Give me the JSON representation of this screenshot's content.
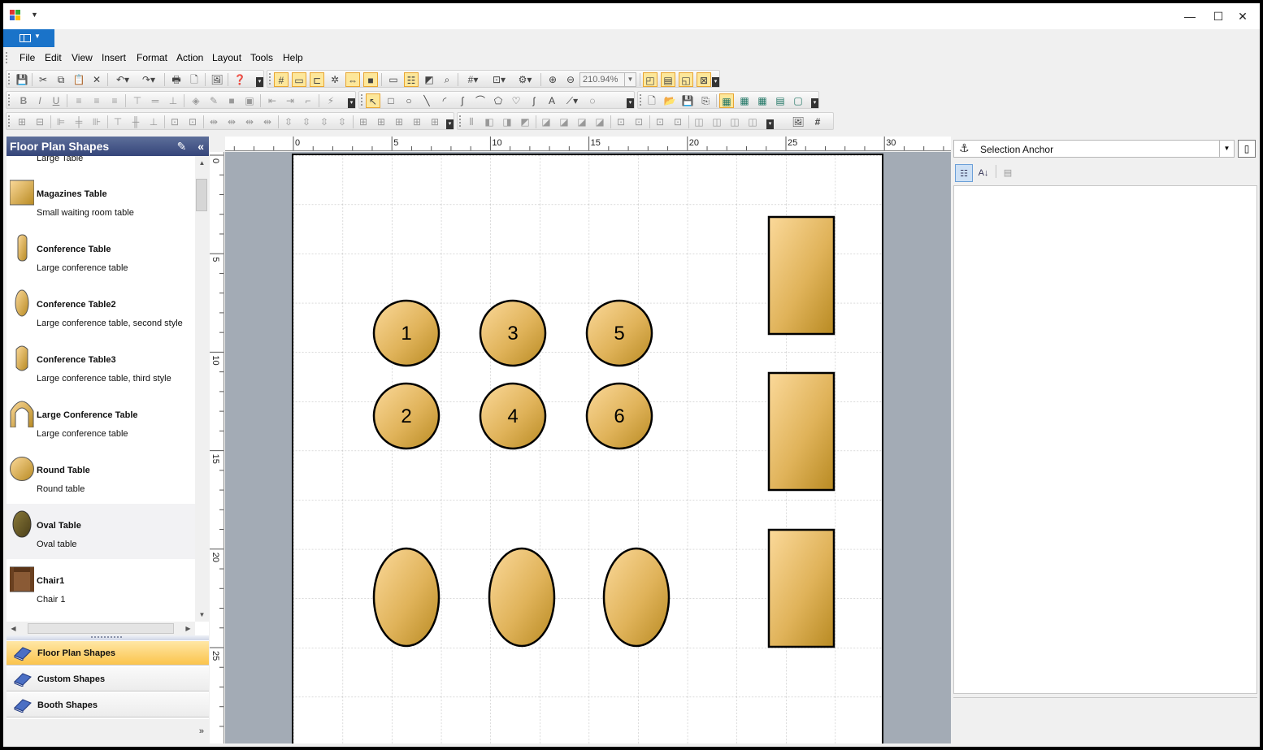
{
  "window": {
    "controls": {
      "minimize": "—",
      "maximize": "☐",
      "close": "✕"
    }
  },
  "menubar": {
    "items": [
      "File",
      "Edit",
      "View",
      "Insert",
      "Format",
      "Action",
      "Layout",
      "Tools",
      "Help"
    ]
  },
  "toolbar": {
    "zoom_value": "210.94%"
  },
  "left_panel": {
    "title": "Floor Plan Shapes",
    "partial_item": "Large Table",
    "shapes": [
      {
        "name": "Magazines Table",
        "desc": "Small waiting room table",
        "icon": "magazines-table-icon"
      },
      {
        "name": "Conference Table",
        "desc": "Large conference table",
        "icon": "conference-table-icon"
      },
      {
        "name": "Conference Table2",
        "desc": "Large conference table, second style",
        "icon": "conference-table2-icon"
      },
      {
        "name": "Conference Table3",
        "desc": "Large conference table, third style",
        "icon": "conference-table3-icon"
      },
      {
        "name": "Large Conference Table",
        "desc": "Large conference table",
        "icon": "large-conference-table-icon"
      },
      {
        "name": "Round Table",
        "desc": "Round table",
        "icon": "round-table-icon"
      },
      {
        "name": "Oval Table",
        "desc": "Oval table",
        "icon": "oval-table-icon"
      },
      {
        "name": "Chair1",
        "desc": "Chair 1",
        "icon": "chair-icon"
      }
    ],
    "categories": [
      {
        "label": "Floor Plan Shapes",
        "active": true
      },
      {
        "label": "Custom Shapes",
        "active": false
      },
      {
        "label": "Booth Shapes",
        "active": false
      }
    ]
  },
  "rulers": {
    "horizontal_labels": [
      "0",
      "5",
      "10",
      "15",
      "20",
      "25",
      "30"
    ],
    "vertical_labels": [
      "0",
      "5",
      "10",
      "15",
      "20",
      "25"
    ]
  },
  "canvas": {
    "round_table_labels": [
      "1",
      "3",
      "5",
      "2",
      "4",
      "6"
    ],
    "fill_colors": {
      "light": "#fbd99a",
      "dark": "#b88a22"
    }
  },
  "right_panel": {
    "selector_label": "Selection Anchor"
  }
}
